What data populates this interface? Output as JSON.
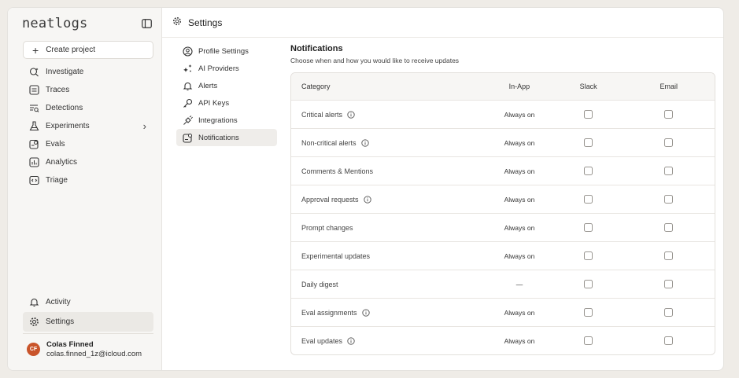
{
  "sidebar": {
    "logo": "neatlogs",
    "create_project": "Create project",
    "items": [
      {
        "label": "Investigate",
        "icon": "search-sparkle-icon"
      },
      {
        "label": "Traces",
        "icon": "list-box-icon"
      },
      {
        "label": "Detections",
        "icon": "filter-search-icon"
      },
      {
        "label": "Experiments",
        "icon": "flask-icon",
        "has_submenu": true
      },
      {
        "label": "Evals",
        "icon": "clipboard-check-icon"
      },
      {
        "label": "Analytics",
        "icon": "chart-box-icon"
      },
      {
        "label": "Triage",
        "icon": "code-box-icon"
      }
    ],
    "bottom": [
      {
        "label": "Activity",
        "icon": "bell-icon"
      },
      {
        "label": "Settings",
        "icon": "gear-icon"
      }
    ],
    "user": {
      "initials": "CF",
      "name": "Colas Finned",
      "email": "colas.finned_1z@icloud.com"
    }
  },
  "header": {
    "title": "Settings"
  },
  "settings_nav": [
    {
      "label": "Profile Settings",
      "icon": "user-circle-icon"
    },
    {
      "label": "AI Providers",
      "icon": "sparkles-icon"
    },
    {
      "label": "Alerts",
      "icon": "bell-icon"
    },
    {
      "label": "API Keys",
      "icon": "key-icon"
    },
    {
      "label": "Integrations",
      "icon": "plug-icon"
    },
    {
      "label": "Notifications",
      "icon": "notification-box-icon",
      "active": true
    }
  ],
  "notifications": {
    "title": "Notifications",
    "subtitle": "Choose when and how you would like to receive updates",
    "columns": {
      "category": "Category",
      "in_app": "In-App",
      "slack": "Slack",
      "email": "Email"
    },
    "rows": [
      {
        "category": "Critical alerts",
        "info": true,
        "in_app": "Always on",
        "slack": false,
        "email": false
      },
      {
        "category": "Non-critical alerts",
        "info": true,
        "in_app": "Always on",
        "slack": false,
        "email": false
      },
      {
        "category": "Comments & Mentions",
        "info": false,
        "in_app": "Always on",
        "slack": false,
        "email": false
      },
      {
        "category": "Approval requests",
        "info": true,
        "in_app": "Always on",
        "slack": false,
        "email": false
      },
      {
        "category": "Prompt changes",
        "info": false,
        "in_app": "Always on",
        "slack": false,
        "email": false
      },
      {
        "category": "Experimental updates",
        "info": false,
        "in_app": "Always on",
        "slack": false,
        "email": false
      },
      {
        "category": "Daily digest",
        "info": false,
        "in_app": "—",
        "slack": false,
        "email": false
      },
      {
        "category": "Eval assignments",
        "info": true,
        "in_app": "Always on",
        "slack": false,
        "email": false
      },
      {
        "category": "Eval updates",
        "info": true,
        "in_app": "Always on",
        "slack": false,
        "email": false
      }
    ]
  },
  "colors": {
    "avatar": "#c9542a",
    "background": "#efece7",
    "sidebar": "#f7f6f4"
  }
}
